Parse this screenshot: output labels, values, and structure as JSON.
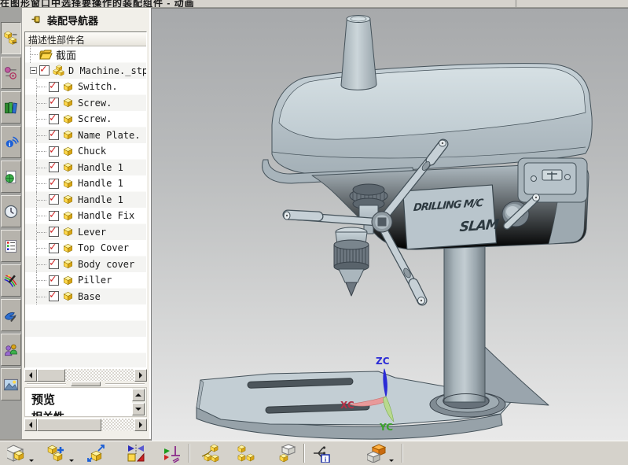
{
  "window": {
    "prompt_bar_clipped_text": "在图形窗口中选择要操作的装配组件 - 动画",
    "app_context": "assembly-modeling"
  },
  "resource_bar": {
    "items": [
      {
        "name": "assembly-navigator-tab",
        "icon": "yellow-cubes-icon",
        "active": true
      },
      {
        "name": "constraint-navigator-tab",
        "icon": "constraint-target-icon",
        "active": false
      },
      {
        "name": "library-tab",
        "icon": "books-icon",
        "active": false
      },
      {
        "name": "internet-tab",
        "icon": "internet-info-icon",
        "active": false
      },
      {
        "name": "web-browser-tab",
        "icon": "page-globe-icon",
        "active": false
      },
      {
        "name": "history-tab",
        "icon": "clock-icon",
        "active": false
      },
      {
        "name": "system-materials-tab",
        "icon": "material-list-icon",
        "active": false
      },
      {
        "name": "visualization-tab",
        "icon": "magic-wand-icon",
        "active": false
      },
      {
        "name": "roles-tab",
        "icon": "blue-bird-icon",
        "active": false
      },
      {
        "name": "users-tab",
        "icon": "two-users-icon",
        "active": false
      },
      {
        "name": "scene-tab",
        "icon": "mountain-image-icon",
        "active": false
      }
    ]
  },
  "navigator": {
    "title": "装配导航器",
    "pin_icon": "pushpin-icon",
    "column_header": "描述性部件名",
    "section_label": "截面",
    "root": {
      "label": "D Machine._stp",
      "checked": true,
      "expanded": true,
      "icon": "assembly-cubes-icon"
    },
    "children": [
      "Switch.",
      "Screw.",
      "Screw.",
      "Name Plate.",
      "Chuck",
      "Handle 1",
      "Handle 1",
      "Handle 1",
      "Handle Fix",
      "Lever",
      "Top Cover",
      "Body cover",
      "Piller",
      "Base"
    ],
    "child_icon": "component-cube-icon",
    "check_color": "#cf1d1d",
    "preview_label": "预览",
    "dependencies_label": "相关性"
  },
  "viewport": {
    "model": "bench drill press (D Machine assembly)",
    "nameplate": {
      "line1": "DRILLING M/C",
      "line2": "SLAM"
    },
    "triad": {
      "z_label": "ZC",
      "x_label": "XC",
      "y_label": "YC",
      "z_color": "#2b2bd6",
      "x_color": "#b43046",
      "y_color": "#3aa32a"
    },
    "colors": {
      "body": "#b7c3ca",
      "body_top": "#cdd8dd",
      "body_dark": "#9aa6ae",
      "outline": "#45525a",
      "background_top": "#a7a9ab",
      "background_bottom": "#e9e9e9"
    }
  },
  "bottom_toolbar": {
    "items": [
      {
        "name": "find-component-button",
        "icon": "cube-stack-icon"
      },
      {
        "name": "add-component-button",
        "icon": "add-cube-plus-icon",
        "dropdown": true
      },
      {
        "name": "move-component-button",
        "icon": "move-cube-arrows-icon",
        "dropdown": true
      },
      {
        "name": "mirror-assembly-button",
        "icon": "mirror-bowtie-icon"
      },
      {
        "name": "assembly-constraints-button",
        "icon": "constraint-arrows-icon"
      },
      {
        "name": "exploded-views-button",
        "icon": "exploded-cubes-icon"
      },
      {
        "name": "show-product-outline-button",
        "icon": "three-cubes-icon"
      },
      {
        "name": "sequence-button",
        "icon": "sequence-cubes-icon"
      },
      {
        "name": "assembly-information-button",
        "icon": "tree-info-icon"
      },
      {
        "name": "wave-geometry-linker-button",
        "icon": "orange-gray-cubes-icon",
        "dropdown": true
      }
    ]
  },
  "icon_colors": {
    "cube_face": "#ffd84d",
    "cube_top": "#fff3a0",
    "cube_side": "#d9a516"
  }
}
